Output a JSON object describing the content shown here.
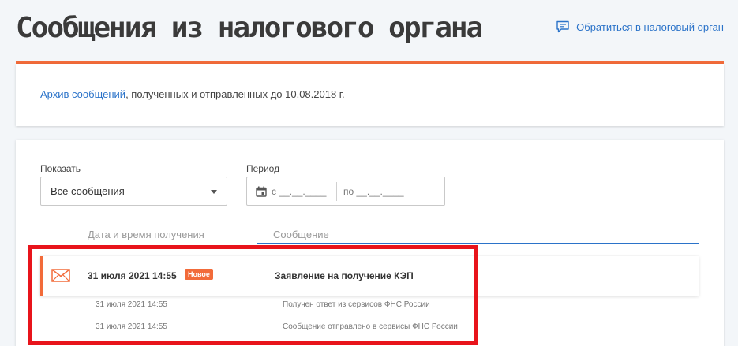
{
  "header": {
    "title": "Сообщения из налогового органа",
    "contact_link": "Обратиться в налоговый орган"
  },
  "archive": {
    "link_text": "Архив сообщений",
    "rest_text": ", полученных и отправленных до 10.08.2018 г."
  },
  "filters": {
    "show_label": "Показать",
    "show_value": "Все сообщения",
    "period_label": "Период",
    "from_placeholder": "с __.__.____",
    "to_placeholder": "по __.__.____"
  },
  "table": {
    "col_date": "Дата и время получения",
    "col_message": "Сообщение"
  },
  "message": {
    "date": "31 июля 2021 14:55",
    "badge": "Новое",
    "subject": "Заявление на получение КЭП",
    "events": [
      {
        "date": "31 июля 2021 14:55",
        "text": "Получен ответ из сервисов ФНС России"
      },
      {
        "date": "31 июля 2021 14:55",
        "text": "Сообщение отправлено в сервисы ФНС России"
      }
    ]
  },
  "colors": {
    "accent": "#f26b3a",
    "link": "#2b73c9",
    "highlight": "#e8141b"
  },
  "icons": {
    "contact": "chat-icon",
    "calendar": "calendar-icon",
    "message": "envelope-icon",
    "dropdown": "caret-down-icon"
  }
}
